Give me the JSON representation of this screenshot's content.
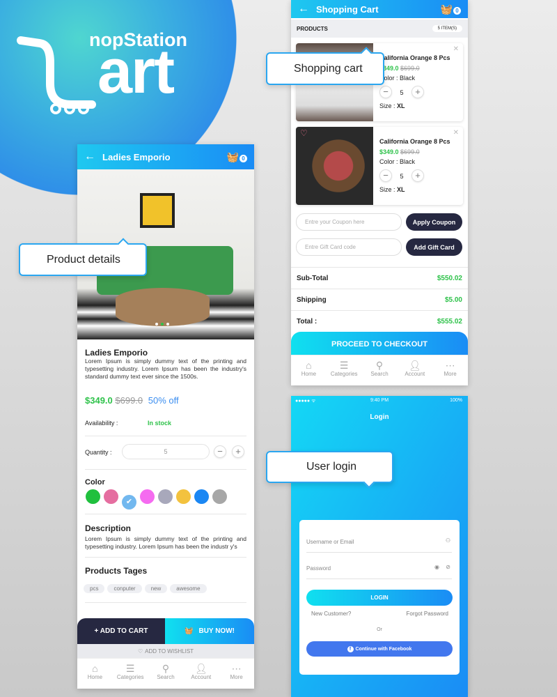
{
  "brand": {
    "logo_small": "nopStation",
    "logo_big": "Cart",
    "accent": "#1a8cf5",
    "dark": "#262841",
    "green": "#2ec24a"
  },
  "callouts": {
    "cart": "Shopping cart",
    "product": "Product details",
    "login": "User login"
  },
  "product": {
    "header_title": "Ladies Emporio",
    "cart_count": "0",
    "name": "Ladies Emporio",
    "summary": "Lorem Ipsum is simply dummy text of the printing and typesetting industry. Lorem Ipsum has been the industry's standard dummy text ever since the 1500s.",
    "price": "$349.0",
    "old_price": "$699.0",
    "discount": "50% off",
    "availability_label": "Availability :",
    "availability_value": "In stock",
    "quantity_label": "Quantity :",
    "quantity_value": "5",
    "color_label": "Color",
    "colors": [
      "#20c03e",
      "#e56ea0",
      "#72b8ef",
      "#f56bf0",
      "#a8a8bb",
      "#f3c23e",
      "#1b87f3",
      "#a7a7a7"
    ],
    "selected_color": 2,
    "description_title": "Description",
    "description": "Lorem Ipsum is simply dummy text of the printing and typesetting industry. Lorem Ipsum has been the industr y's",
    "tags_title": "Products Tages",
    "tags": [
      "pcs",
      "conputer",
      "new",
      "awesome"
    ],
    "add_to_cart": "+ ADD TO CART",
    "buy_now": "BUY NOW!",
    "wishlist": "ADD TO WISHLIST",
    "image_slide": 2,
    "image_slides": 3
  },
  "nav": [
    "Home",
    "Categories",
    "Search",
    "Account",
    "More"
  ],
  "cart": {
    "header_title": "Shopping Cart",
    "cart_count": "0",
    "products_label": "PRODUCTS",
    "items_badge": "5 ITEM(S)",
    "items": [
      {
        "name": "California Orange 8 Pcs",
        "price": "$349.0",
        "old_price": "$699.0",
        "color": "Color : Black",
        "qty": "5",
        "size_label": "Size :",
        "size": "XL"
      },
      {
        "name": "California Orange 8 Pcs",
        "price": "$349.0",
        "old_price": "$699.0",
        "color": "Color : Black",
        "qty": "5",
        "size_label": "Size :",
        "size": "XL"
      }
    ],
    "coupon_placeholder": "Entre your Coupon here",
    "apply_coupon": "Apply Coupon",
    "gift_placeholder": "Entre Gift Card code",
    "add_gift": "Add Gift Card",
    "subtotal_label": "Sub-Total",
    "subtotal": "$550.02",
    "shipping_label": "Shipping",
    "shipping": "$5.00",
    "total_label": "Total :",
    "total": "$555.02",
    "checkout": "PROCEED TO CHECKOUT"
  },
  "login": {
    "status_signal": "●●●●● ᯤ",
    "status_time": "9:40 PM",
    "status_battery": "100%",
    "title": "Login",
    "username_placeholder": "Username or Email",
    "password_placeholder": "Password",
    "login_button": "LOGIN",
    "new_customer": "New Customer?",
    "forgot": "Forgot Password",
    "or": "Or",
    "facebook": "Continue with Facebook"
  }
}
